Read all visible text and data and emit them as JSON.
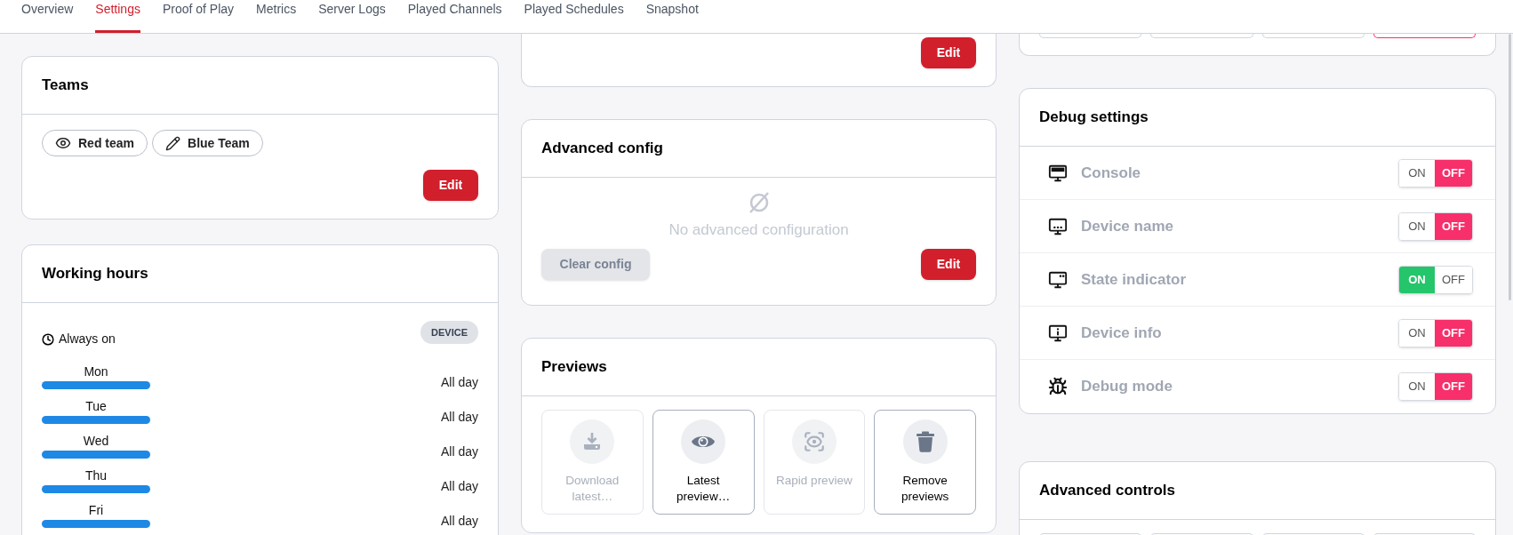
{
  "tabs": [
    {
      "label": "Overview",
      "selected": false
    },
    {
      "label": "Settings",
      "selected": true
    },
    {
      "label": "Proof of Play",
      "selected": false
    },
    {
      "label": "Metrics",
      "selected": false
    },
    {
      "label": "Server Logs",
      "selected": false
    },
    {
      "label": "Played Channels",
      "selected": false
    },
    {
      "label": "Played Schedules",
      "selected": false
    },
    {
      "label": "Snapshot",
      "selected": false
    }
  ],
  "teams": {
    "title": "Teams",
    "tags": [
      {
        "label": "Red team",
        "kind": "view"
      },
      {
        "label": "Blue Team",
        "kind": "edit"
      }
    ],
    "edit_button": "Edit"
  },
  "working_hours": {
    "title": "Working hours",
    "mode": "Always on",
    "badge": "DEVICE",
    "days": [
      {
        "day": "Mon",
        "hours": "All day"
      },
      {
        "day": "Tue",
        "hours": "All day"
      },
      {
        "day": "Wed",
        "hours": "All day"
      },
      {
        "day": "Thu",
        "hours": "All day"
      },
      {
        "day": "Fri",
        "hours": "All day"
      }
    ]
  },
  "top_middle_card": {
    "edit_button": "Edit"
  },
  "advanced_config": {
    "title": "Advanced config",
    "empty_text": "No advanced configuration",
    "clear_button": {
      "label": "Clear config",
      "disabled": true
    },
    "edit_button": "Edit"
  },
  "previews": {
    "title": "Previews",
    "actions": [
      {
        "label": "Download latest…",
        "kind": "download",
        "disabled": true
      },
      {
        "label": "Latest preview…",
        "kind": "view",
        "disabled": false
      },
      {
        "label": "Rapid preview",
        "kind": "rapid",
        "disabled": true
      },
      {
        "label": "Remove previews",
        "kind": "remove",
        "disabled": false
      }
    ]
  },
  "top_right_card": {
    "buttons": [
      {
        "highlighted": false
      },
      {
        "highlighted": false
      },
      {
        "highlighted": false
      },
      {
        "highlighted": true
      }
    ]
  },
  "debug_settings": {
    "title": "Debug settings",
    "items": [
      {
        "label": "Console",
        "kind": "console",
        "on": false,
        "on_label": "ON",
        "off_label": "OFF"
      },
      {
        "label": "Device name",
        "kind": "name",
        "on": false,
        "on_label": "ON",
        "off_label": "OFF"
      },
      {
        "label": "State indicator",
        "kind": "state",
        "on": true,
        "on_label": "ON",
        "off_label": "OFF"
      },
      {
        "label": "Device info",
        "kind": "info",
        "on": false,
        "on_label": "ON",
        "off_label": "OFF"
      },
      {
        "label": "Debug mode",
        "kind": "bug",
        "on": false,
        "on_label": "ON",
        "off_label": "OFF"
      }
    ]
  },
  "advanced_controls": {
    "title": "Advanced controls",
    "buttons": [
      {
        "highlighted": false
      },
      {
        "highlighted": false
      },
      {
        "highlighted": false
      },
      {
        "highlighted": false
      }
    ]
  }
}
